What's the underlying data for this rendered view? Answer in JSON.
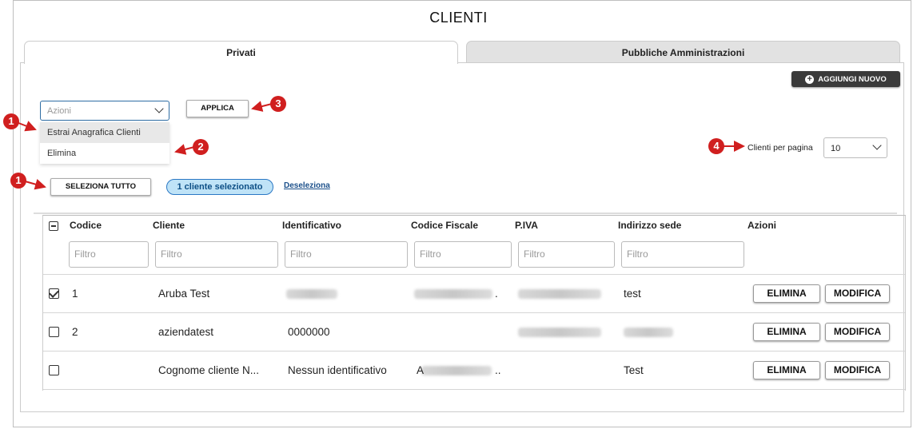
{
  "page": {
    "title": "CLIENTI"
  },
  "tabs": [
    {
      "label": "Privati",
      "active": true
    },
    {
      "label": "Pubbliche Amministrazioni",
      "active": false
    }
  ],
  "toolbar": {
    "add_label": "AGGIUNGI NUOVO",
    "actions_placeholder": "Azioni",
    "actions_options": [
      "Estrai Anagrafica Clienti",
      "Elimina"
    ],
    "apply_label": "APPLICA",
    "select_all_label": "SELEZIONA TUTTO",
    "selected_badge": "1 cliente selezionato",
    "deselect_label": "Deseleziona",
    "per_page_label": "Clienti per pagina",
    "per_page_value": "10"
  },
  "markers": [
    "1",
    "1",
    "2",
    "3",
    "4"
  ],
  "table": {
    "columns": [
      "Codice",
      "Cliente",
      "Identificativo",
      "Codice Fiscale",
      "P.IVA",
      "Indirizzo sede",
      "Azioni"
    ],
    "filter_placeholder": "Filtro",
    "rows": [
      {
        "checked": true,
        "codice": "1",
        "cliente": "Aruba Test",
        "identificativo": "",
        "codice_fiscale": ".",
        "piva": "",
        "indirizzo": "test"
      },
      {
        "checked": false,
        "codice": "2",
        "cliente": "aziendatest",
        "identificativo": "0000000",
        "codice_fiscale": "",
        "piva": "",
        "indirizzo": ""
      },
      {
        "checked": false,
        "codice": "",
        "cliente": "Cognome cliente N...",
        "identificativo": "Nessun identificativo",
        "codice_fiscale": "A ..",
        "piva": "",
        "indirizzo": "Test"
      }
    ],
    "delete_label": "ELIMINA",
    "edit_label": "MODIFICA"
  },
  "colors": {
    "accent": "#2e6da4",
    "marker": "#d01f1f",
    "badge_bg": "#bfe3f7",
    "dark_button": "#3a3a3a"
  }
}
